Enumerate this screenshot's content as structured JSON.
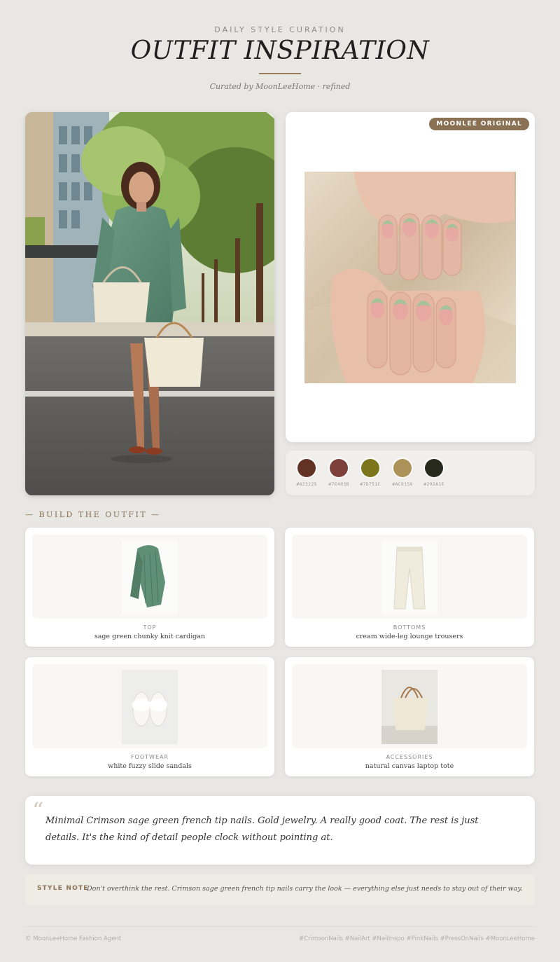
{
  "header": {
    "kicker": "DAILY STYLE CURATION",
    "title": "OUTFIT INSPIRATION",
    "curated": "Curated by MoonLeeHome · refined"
  },
  "nail_card": {
    "badge": "MOONLEE ORIGINAL"
  },
  "palette": [
    {
      "hex": "#623225",
      "color": "#623225"
    },
    {
      "hex": "#7E403B",
      "color": "#7E403B"
    },
    {
      "hex": "#7D751C",
      "color": "#7D751C"
    },
    {
      "hex": "#AC9159",
      "color": "#AC9159"
    },
    {
      "hex": "#292A1E",
      "color": "#292A1E"
    }
  ],
  "section": {
    "label": "— BUILD THE OUTFIT —"
  },
  "items": [
    {
      "category": "TOP",
      "name": "sage green chunky knit cardigan"
    },
    {
      "category": "BOTTOMS",
      "name": "cream wide-leg lounge trousers"
    },
    {
      "category": "FOOTWEAR",
      "name": "white fuzzy slide sandals"
    },
    {
      "category": "ACCESSORIES",
      "name": "natural canvas laptop tote"
    }
  ],
  "quote": {
    "mark": "“",
    "text": "Minimal Crimson sage green french tip nails. Gold jewelry. A really good coat. The rest is just details. It's the kind of detail people clock without pointing at."
  },
  "style_note": {
    "label": "STYLE NOTE",
    "text": "Don't overthink the rest. Crimson sage green french tip nails carry the look — everything else just needs to stay out of their way."
  },
  "footer": {
    "left": "© MoonLeeHome Fashion Agent",
    "right": "#CrimsonNails #NailArt #NailInspo #PinkNails #PressOnNails #MoonLeeHome"
  }
}
